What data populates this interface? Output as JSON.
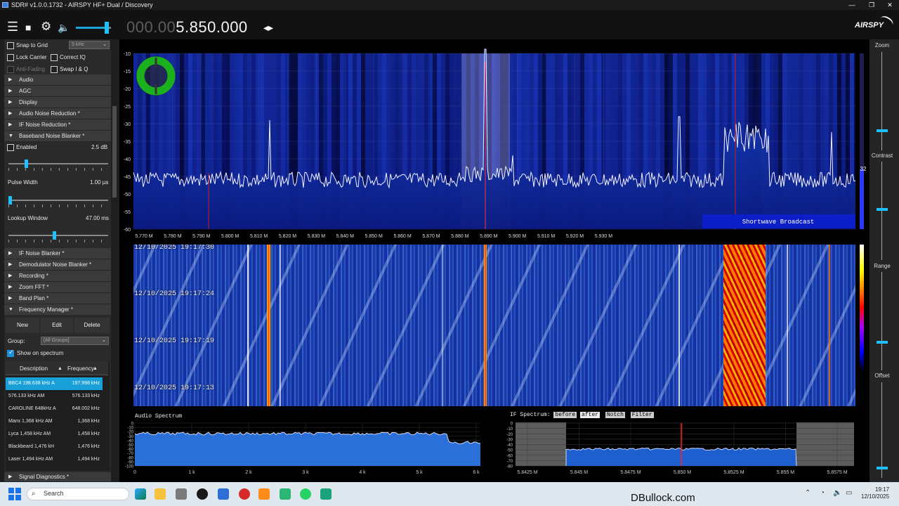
{
  "window": {
    "title": "SDR# v1.0.0.1732 - AIRSPY HF+ Dual / Discovery",
    "minimize": "—",
    "maximize": "❐",
    "close": "✕"
  },
  "toolbar": {
    "menu_icon": "☰",
    "stop_icon": "■",
    "settings_icon": "⚙",
    "volume_icon": "🔈",
    "freq_dim": "000.00",
    "freq_lit": "5.850.000",
    "arrows": "◂▸",
    "logo": "AIRSPY"
  },
  "left": {
    "snap": "Snap to Grid",
    "snap_value": "5 kHz",
    "lock_carrier": "Lock Carrier",
    "correct_iq": "Correct IQ",
    "anti_fading": "Anti-Fading",
    "swap_iq": "Swap I & Q",
    "sections_top": [
      "Audio",
      "AGC",
      "Display",
      "Audio Noise Reduction *",
      "IF Noise Reduction *",
      "Baseband Noise Blanker *"
    ],
    "enabled": "Enabled",
    "enabled_value": "2.5 dB",
    "pulse_width": "Pulse Width",
    "pulse_width_value": "1.00 µs",
    "lookup_window": "Lookup Window",
    "lookup_window_value": "47.00 ms",
    "sections_bottom": [
      "IF Noise Blanker *",
      "Demodulator Noise Blanker *",
      "Recording *",
      "Zoom FFT *",
      "Band Plan *",
      "Frequency Manager *"
    ],
    "buttons": {
      "new": "New",
      "edit": "Edit",
      "delete": "Delete"
    },
    "group_label": "Group:",
    "group_value": "[All Groups]",
    "show_on_spectrum": "Show on spectrum",
    "col_description": "Description",
    "col_frequency": "Frequency",
    "rows": [
      {
        "desc": "BBC4 198.638 kHz A",
        "freq": "197.998 kHz"
      },
      {
        "desc": "576.133 kHz AM",
        "freq": "576.133 kHz"
      },
      {
        "desc": "CAROLINE 648kHz A",
        "freq": "648.002 kHz"
      },
      {
        "desc": "Manx 1,368 kHz AM",
        "freq": "1,368 kHz"
      },
      {
        "desc": "Lyca 1,458 kHz AM",
        "freq": "1,458 kHz"
      },
      {
        "desc": "Blackbeard 1,476 kH",
        "freq": "1,476 kHz"
      },
      {
        "desc": "Laser 1,494 kHz AM",
        "freq": "1,494 kHz"
      }
    ],
    "signal_diagnostics": "Signal Diagnostics *"
  },
  "right": {
    "zoom": "Zoom",
    "contrast": "Contrast",
    "range": "Range",
    "offset": "Offset"
  },
  "spectrum": {
    "y_ticks": [
      "-10",
      "-15",
      "-20",
      "-25",
      "-30",
      "-35",
      "-40",
      "-45",
      "-50",
      "-55",
      "-60"
    ],
    "x_ticks": [
      "5.770 M",
      "5.780 M",
      "5.790 M",
      "5.800 M",
      "5.810 M",
      "5.820 M",
      "5.830 M",
      "5.840 M",
      "5.850 M",
      "5.860 M",
      "5.870 M",
      "5.880 M",
      "5.890 M",
      "5.900 M",
      "5.910 M",
      "5.920 M",
      "5.930 M"
    ],
    "band_label": "Shortwave Broadcast",
    "snr": "32"
  },
  "waterfall": {
    "stamps": [
      "12/10/2025 19:17:30",
      "12/10/2025 19:17:24",
      "12/10/2025 19:17:19",
      "12/10/2025 19:17:13"
    ]
  },
  "audio": {
    "title": "Audio Spectrum",
    "y_ticks": [
      "0",
      "-10",
      "-20",
      "-30",
      "-40",
      "-50",
      "-60",
      "-70",
      "-80",
      "-90",
      "-100"
    ],
    "x_ticks": [
      "0",
      "1 k",
      "2 k",
      "3 k",
      "4 k",
      "5 k",
      "6 k"
    ]
  },
  "ifspec": {
    "title": "IF Spectrum:",
    "before": "before",
    "after": "after",
    "notch": "Notch",
    "filter": "Filter",
    "y_ticks": [
      "0",
      "-10",
      "-20",
      "-30",
      "-40",
      "-50",
      "-60",
      "-70",
      "-80"
    ],
    "x_ticks": [
      "5.8425 M",
      "5.845 M",
      "5.8475 M",
      "5.850 M",
      "5.8525 M",
      "5.855 M",
      "5.8575 M"
    ]
  },
  "taskbar": {
    "search": "Search",
    "time": "19:17",
    "date": "12/10/2025"
  },
  "watermark": "DBullock.com"
}
